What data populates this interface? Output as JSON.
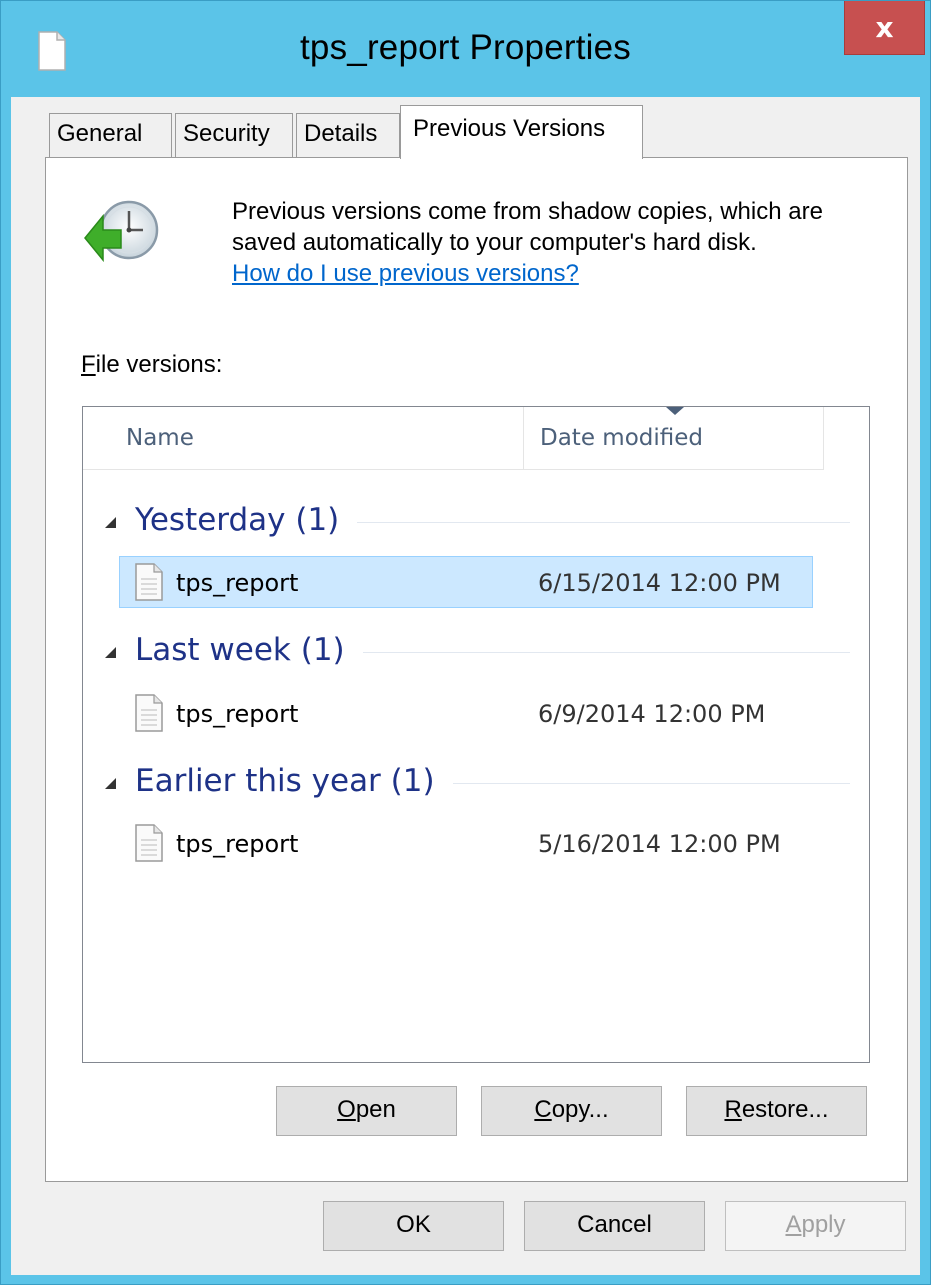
{
  "window": {
    "title": "tps_report Properties",
    "close_label": "x"
  },
  "tabs": [
    {
      "label": "General",
      "active": false
    },
    {
      "label": "Security",
      "active": false
    },
    {
      "label": "Details",
      "active": false
    },
    {
      "label": "Previous Versions",
      "active": true
    }
  ],
  "info": {
    "text": "Previous versions come from shadow copies, which are saved automatically to your computer's hard disk.",
    "link": "How do I use previous versions?"
  },
  "file_versions": {
    "label_mnemonic": "F",
    "label_rest": "ile versions:",
    "columns": {
      "name": "Name",
      "date": "Date modified"
    },
    "groups": [
      {
        "header": "Yesterday (1)",
        "files": [
          {
            "name": "tps_report",
            "date": "6/15/2014 12:00 PM",
            "selected": true
          }
        ]
      },
      {
        "header": "Last week (1)",
        "files": [
          {
            "name": "tps_report",
            "date": "6/9/2014 12:00 PM",
            "selected": false
          }
        ]
      },
      {
        "header": "Earlier this year (1)",
        "files": [
          {
            "name": "tps_report",
            "date": "5/16/2014 12:00 PM",
            "selected": false
          }
        ]
      }
    ]
  },
  "actions": {
    "open_mnemonic": "O",
    "open_rest": "pen",
    "copy_mnemonic": "C",
    "copy_rest": "opy...",
    "restore_mnemonic": "R",
    "restore_rest": "estore..."
  },
  "footer": {
    "ok": "OK",
    "cancel": "Cancel",
    "apply_mnemonic": "A",
    "apply_rest": "pply",
    "apply_enabled": false
  },
  "colors": {
    "window_frame": "#5bc4e8",
    "close_button": "#c75050",
    "group_header": "#1e3287",
    "link": "#0066cc",
    "selection": "#cce8ff"
  }
}
